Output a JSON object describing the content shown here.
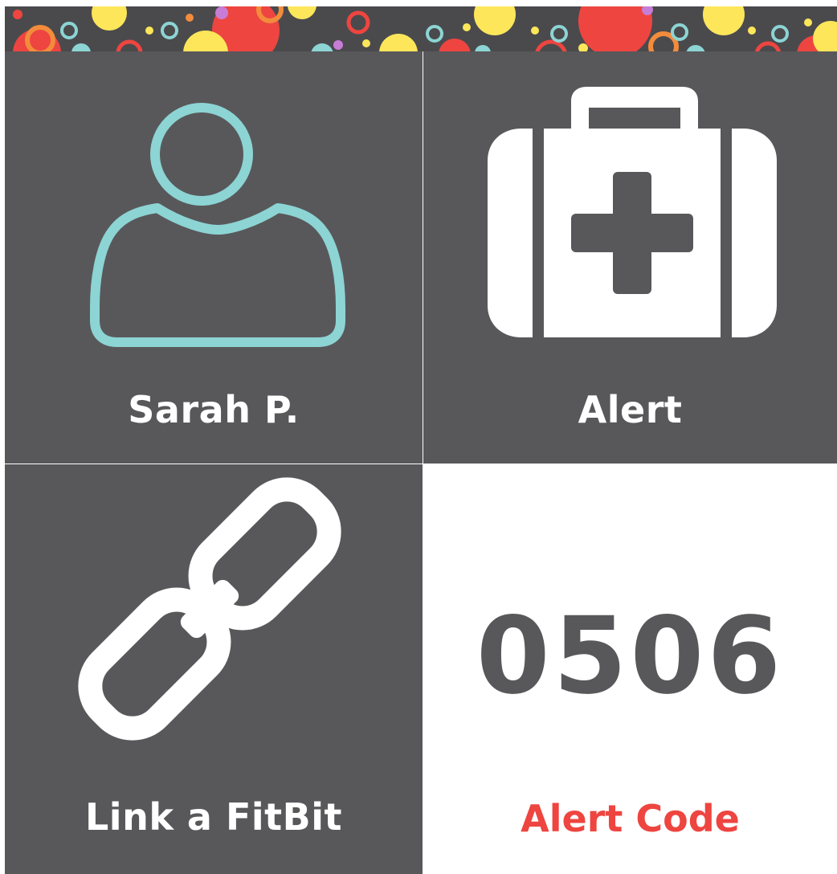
{
  "tiles": {
    "profile": {
      "label": "Sarah P.",
      "icon": "user-icon",
      "icon_color": "#8dd4d4"
    },
    "alert": {
      "label": "Alert",
      "icon": "first-aid-kit-icon",
      "icon_color": "#ffffff"
    },
    "fitbit": {
      "label": "Link a FitBit",
      "icon": "link-chain-icon",
      "icon_color": "#ffffff"
    },
    "code": {
      "value": "0506",
      "label": "Alert Code",
      "value_color": "#58585b",
      "label_color": "#ee4540"
    }
  },
  "theme": {
    "tile_background": "#58585b",
    "banner_colors": [
      "#ee4540",
      "#fde65a",
      "#8dd4d4",
      "#f28c3c",
      "#c77dd6"
    ]
  }
}
